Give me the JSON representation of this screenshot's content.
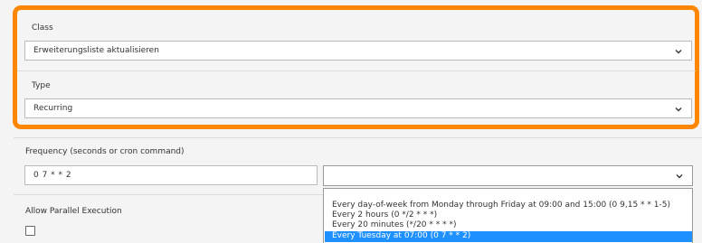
{
  "form": {
    "class_label": "Class",
    "class_value": "Erweiterungsliste aktualisieren",
    "type_label": "Type",
    "type_value": "Recurring",
    "frequency_label": "Frequency (seconds or cron command)",
    "frequency_value": "0 7 * * 2",
    "frequency_preset_value": "",
    "parallel_label": "Allow Parallel Execution",
    "parallel_checked": false
  },
  "frequency_presets": [
    "Every day-of-week from Monday through Friday at 09:00 and 15:00 (0 9,15 * * 1-5)",
    "Every 2 hours (0 */2 * * *)",
    "Every 20 minutes (*/20 * * * *)",
    "Every Tuesday at 07:00 (0 7 * * 2)"
  ],
  "selected_preset_index": 3,
  "colors": {
    "highlight": "#ff8700",
    "selected": "#1e90ff"
  },
  "icons": {
    "select_chevron": "chevron-down-icon"
  }
}
